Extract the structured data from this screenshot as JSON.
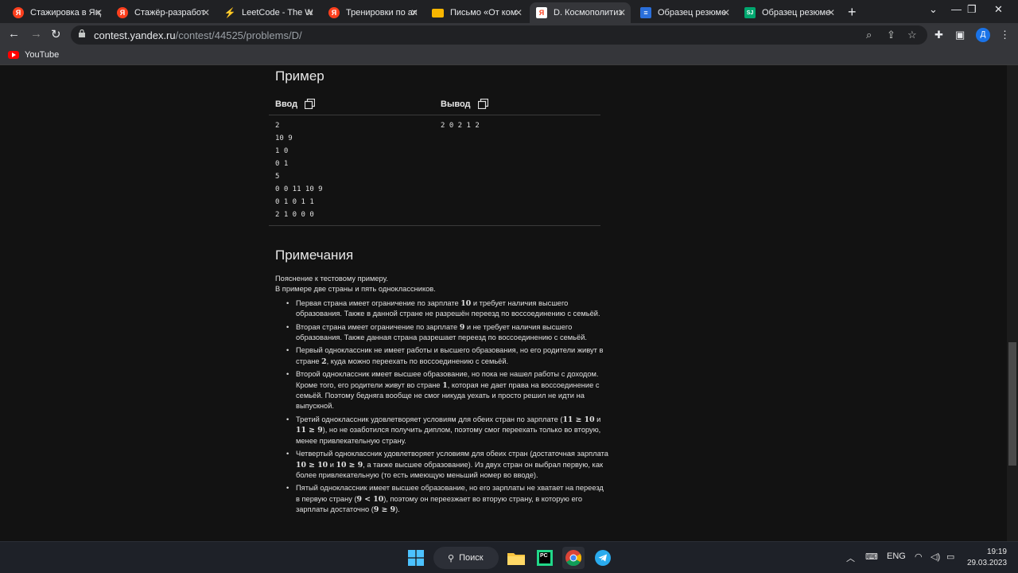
{
  "browser": {
    "tabs": [
      {
        "title": "Стажировка в Янд",
        "favicon": "yandex-icon",
        "color": "#fc3f1d",
        "glyph": "Я"
      },
      {
        "title": "Стажёр-разработ",
        "favicon": "yandex-icon",
        "color": "#fc3f1d",
        "glyph": "Я"
      },
      {
        "title": "LeetCode - The W",
        "favicon": "leetcode-icon",
        "color": "#ffa116",
        "glyph": "L"
      },
      {
        "title": "Тренировки по ал",
        "favicon": "yandex-icon",
        "color": "#fc3f1d",
        "glyph": "Я"
      },
      {
        "title": "Письмо «От ком",
        "favicon": "mail-icon",
        "color": "#f8b600",
        "glyph": "✉"
      },
      {
        "title": "D. Космополитиз",
        "favicon": "yandex-contest-icon",
        "color": "#ffffff",
        "glyph": "D"
      },
      {
        "title": "Образец резюме",
        "favicon": "doc-icon",
        "color": "#2a6fdb",
        "glyph": "≡"
      },
      {
        "title": "Образец резюме",
        "favicon": "sj-icon",
        "color": "#00a76f",
        "glyph": "SJ"
      }
    ],
    "active_tab": 5,
    "url_host": "contest.yandex.ru",
    "url_path": "/contest/44525/problems/D/",
    "profile_initial": "Д",
    "bookmark": "YouTube"
  },
  "problem": {
    "example_heading": "Пример",
    "input_label": "Ввод",
    "output_label": "Вывод",
    "input_lines": [
      "2",
      "10 9",
      "1 0",
      "0 1",
      "5",
      "0 0 11 10 9",
      "0 1 0 1 1",
      "2 1 0 0 0"
    ],
    "output_lines": [
      "2 0 2 1 2"
    ],
    "notes_heading": "Примечания",
    "notes_intro_1": "Пояснение к тестовому примеру.",
    "notes_intro_2": "В примере две страны и пять одноклассников."
  },
  "taskbar": {
    "search_label": "Поиск",
    "lang": "ENG",
    "time": "19:19",
    "date": "29.03.2023"
  }
}
